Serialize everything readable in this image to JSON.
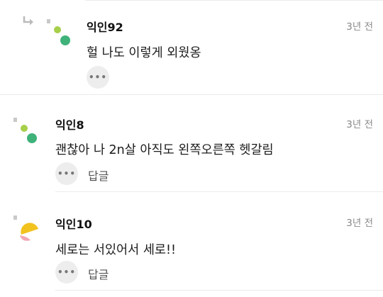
{
  "comments": [
    {
      "nickname": "익인92",
      "time": "3년 전",
      "text": "헐 나도 이렇게 외웠옹",
      "is_reply": true,
      "reply_label": ""
    },
    {
      "nickname": "익인8",
      "time": "3년 전",
      "text": "괜찮아 나 2n살 아직도 왼쪽오른쪽 헷갈림",
      "is_reply": false,
      "reply_label": "답글"
    },
    {
      "nickname": "익인10",
      "time": "3년 전",
      "text": "세로는 서있어서 세로!!",
      "is_reply": false,
      "reply_label": "답글"
    }
  ],
  "more_button_glyph": "•••",
  "colors": {
    "avatar_green_light": "#a6cf4a",
    "avatar_green_dark": "#3fb27a",
    "avatar_yellow": "#f2c21f",
    "avatar_pink": "#f2a6b4",
    "avatar_square": "#c9c9c9",
    "divider": "#ebebeb",
    "more_button_bg": "#ededed"
  },
  "icons": [
    "reply-arrow-icon",
    "avatar-icon",
    "more-icon"
  ]
}
